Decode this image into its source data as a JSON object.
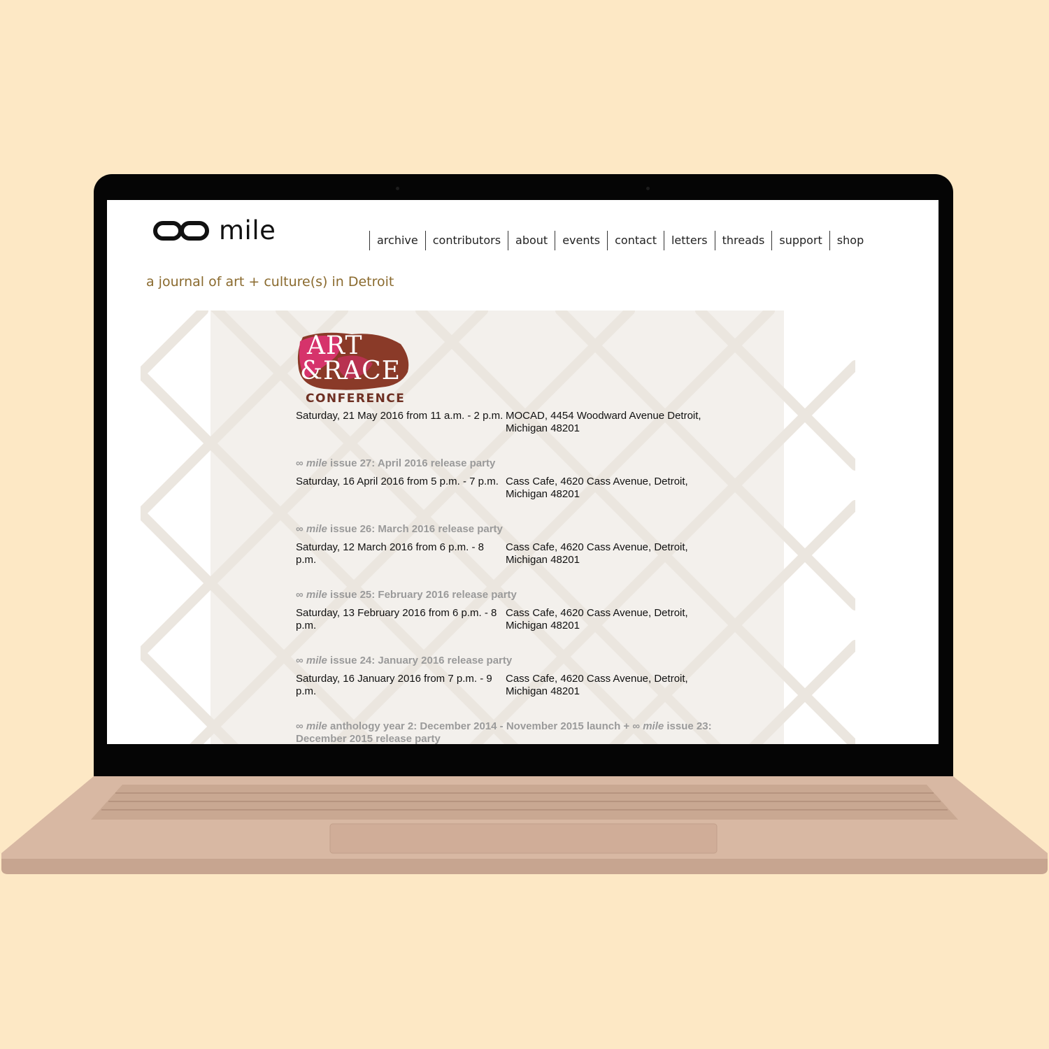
{
  "site": {
    "logo_text": "mile",
    "tagline": "a journal of art + culture(s) in Detroit"
  },
  "nav": {
    "items": [
      "archive",
      "contributors",
      "about",
      "events",
      "contact",
      "letters",
      "threads",
      "support",
      "shop"
    ]
  },
  "conference_logo": {
    "line1": "ART",
    "line2": "&RACE",
    "line3": "CONFERENCE"
  },
  "events": [
    {
      "title_prefix": "",
      "title_italic": "",
      "title_rest": "",
      "when": "Saturday, 21 May 2016 from 11 a.m. - 2 p.m.",
      "where": "MOCAD, 4454 Woodward Avenue Detroit, Michigan 48201"
    },
    {
      "title_prefix": "∞ ",
      "title_italic": "mile",
      "title_rest": " issue 27: April 2016 release party",
      "when": "Saturday, 16 April 2016 from 5 p.m. - 7 p.m.",
      "where": "Cass Cafe, 4620 Cass Avenue, Detroit, Michigan 48201"
    },
    {
      "title_prefix": "∞ ",
      "title_italic": "mile",
      "title_rest": " issue 26: March 2016 release party",
      "when": "Saturday, 12 March 2016 from 6 p.m. - 8 p.m.",
      "where": "Cass Cafe, 4620 Cass Avenue, Detroit, Michigan 48201"
    },
    {
      "title_prefix": "∞ ",
      "title_italic": "mile",
      "title_rest": " issue 25: February 2016 release party",
      "when": "Saturday, 13 February 2016 from 6 p.m. - 8 p.m.",
      "where": "Cass Cafe, 4620 Cass Avenue, Detroit, Michigan 48201"
    },
    {
      "title_prefix": "∞ ",
      "title_italic": "mile",
      "title_rest": " issue 24: January 2016 release party",
      "when": "Saturday, 16 January 2016 from 7 p.m. - 9 p.m.",
      "where": "Cass Cafe, 4620 Cass Avenue, Detroit, Michigan 48201"
    }
  ],
  "last_title": {
    "prefix": "∞ ",
    "italic1": "mile",
    "middle": " anthology year 2: December 2014 - November 2015 launch + ∞ ",
    "italic2": "mile",
    "rest": " issue 23: December 2015 release party"
  },
  "colors": {
    "background": "#fde8c5",
    "tagline": "#8a6a2e",
    "event_title": "#9a9a9a",
    "laptop_base": "#d8b8a3"
  }
}
